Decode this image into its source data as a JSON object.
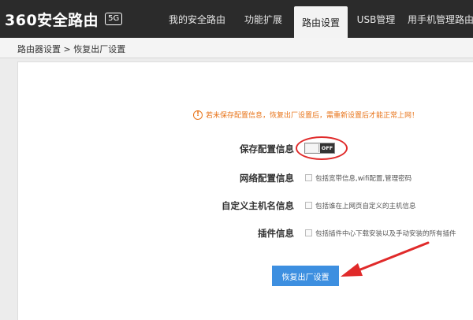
{
  "header": {
    "logo_text": "360安全路由",
    "logo_badge": "5G",
    "nav": [
      {
        "label": "我的安全路由",
        "active": false
      },
      {
        "label": "功能扩展",
        "active": false
      },
      {
        "label": "路由设置",
        "active": true
      },
      {
        "label": "USB管理",
        "active": false
      },
      {
        "label": "用手机管理路由",
        "active": false
      }
    ]
  },
  "breadcrumb": "路由器设置 > 恢复出厂设置",
  "warning": {
    "icon": "!",
    "text": "若未保存配置信息，恢复出厂设置后，需重新设置后才能正常上网！"
  },
  "options": {
    "save_config": {
      "label": "保存配置信息",
      "toggle_text": "OFF",
      "state": "off"
    },
    "network_config": {
      "label": "网络配置信息",
      "desc": "包括宽带信息,wifi配置,管理密码"
    },
    "hostname": {
      "label": "自定义主机名信息",
      "desc": "包括谁在上网页自定义的主机信息"
    },
    "plugins": {
      "label": "插件信息",
      "desc": "包括插件中心下载安装以及手动安装的所有插件"
    }
  },
  "reset_button": "恢复出厂设置",
  "colors": {
    "accent": "#3d8fe0",
    "warning": "#e8741a",
    "annotation": "#e02a2a",
    "header": "#2b2b2b"
  }
}
